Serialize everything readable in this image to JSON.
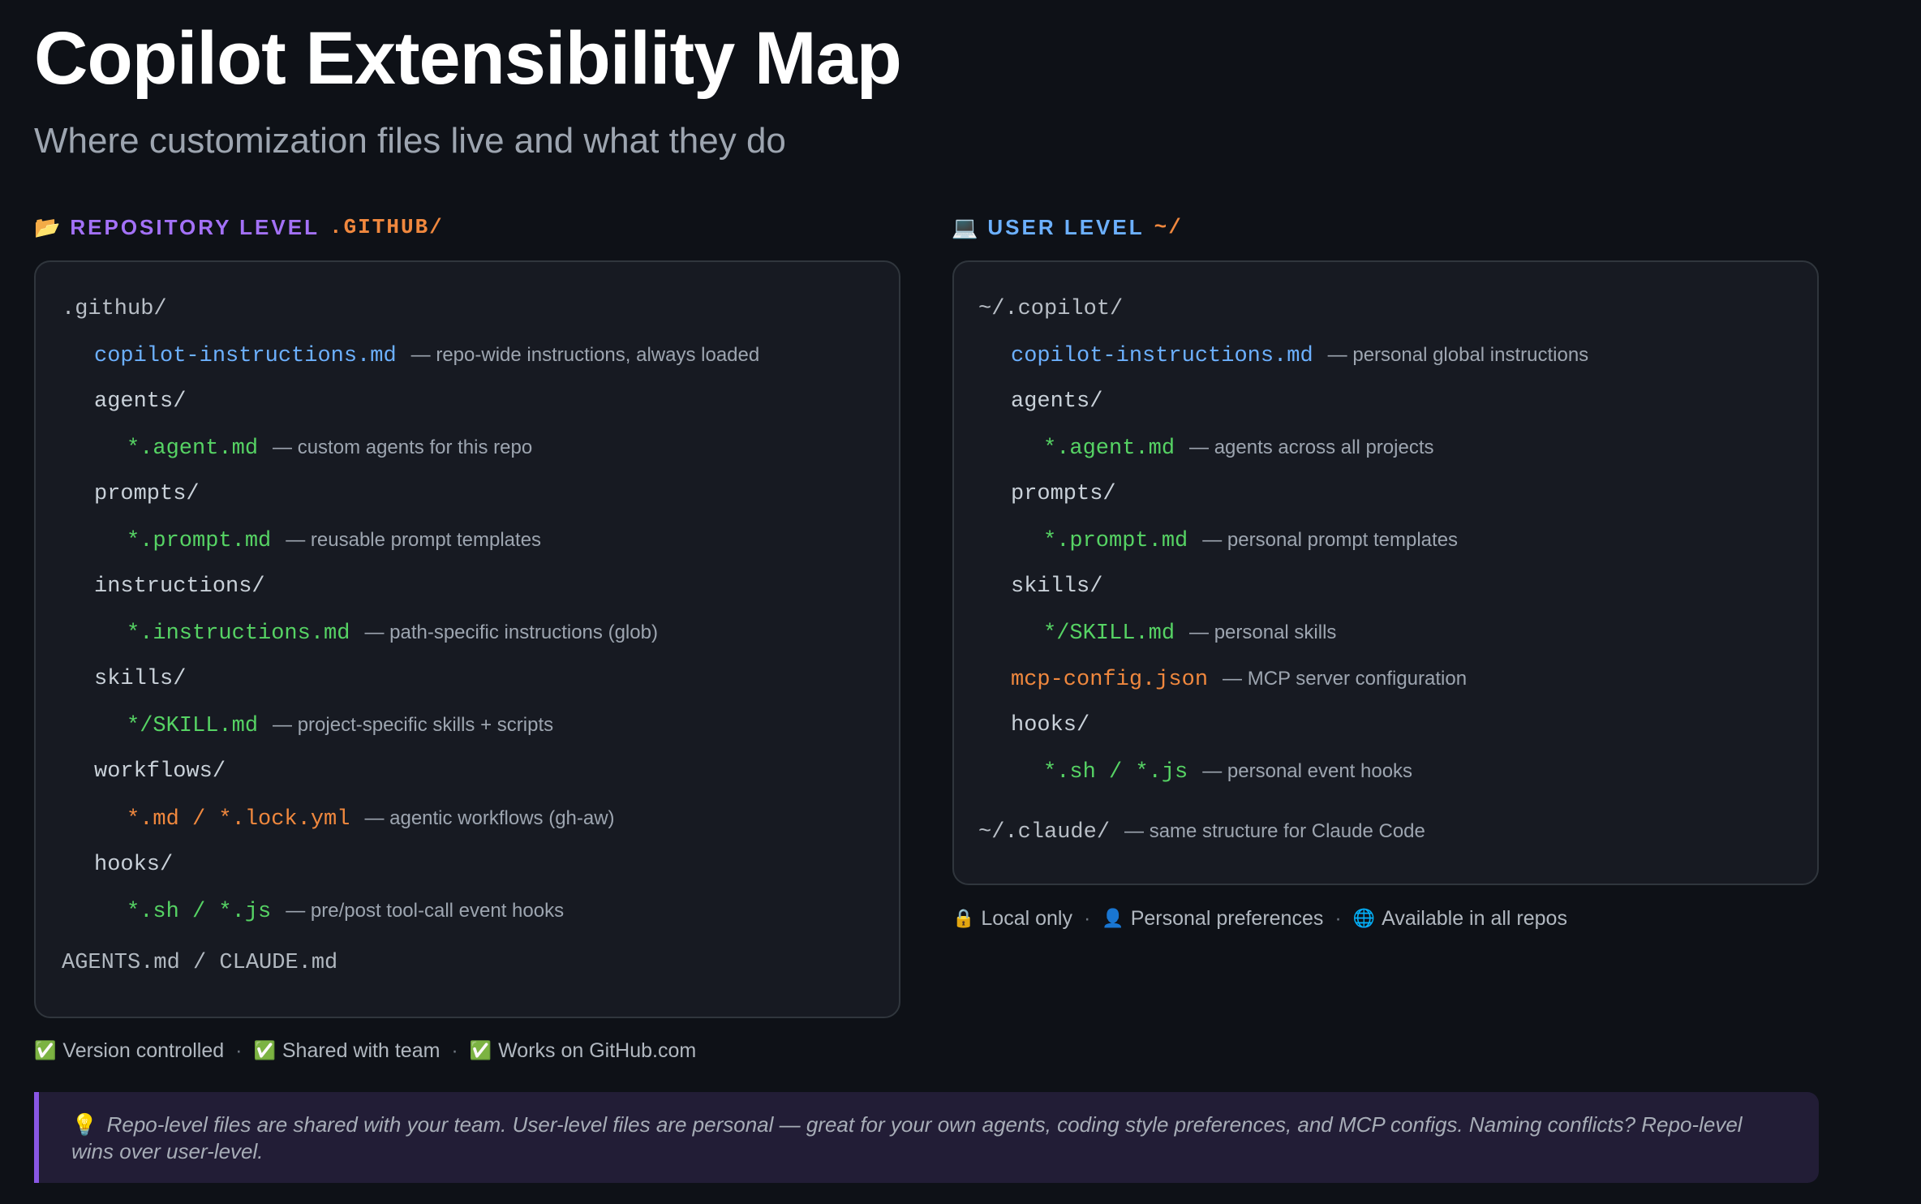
{
  "title": "Copilot Extensibility Map",
  "subtitle": "Where customization files live and what they do",
  "repo": {
    "icon": "folder-icon",
    "icon_glyph": "📂",
    "label": "REPOSITORY LEVEL",
    "path": ".GITHUB/",
    "tree": {
      "root": ".github/",
      "copilot_instructions": {
        "name": "copilot-instructions.md",
        "desc": "— repo-wide instructions, always loaded"
      },
      "agents_dir": "agents/",
      "agent_file": {
        "name": "*.agent.md",
        "desc": "— custom agents for this repo"
      },
      "prompts_dir": "prompts/",
      "prompt_file": {
        "name": "*.prompt.md",
        "desc": "— reusable prompt templates"
      },
      "instructions_dir": "instructions/",
      "instructions_file": {
        "name": "*.instructions.md",
        "desc": "— path-specific instructions (glob)"
      },
      "skills_dir": "skills/",
      "skill_file": {
        "name": "*/SKILL.md",
        "desc": "— project-specific skills + scripts"
      },
      "workflows_dir": "workflows/",
      "workflow_file": {
        "name": "*.md / *.lock.yml",
        "desc": "— agentic workflows (gh-aw)"
      },
      "hooks_dir": "hooks/",
      "hook_file": {
        "name": "*.sh / *.js",
        "desc": "— pre/post tool-call event hooks"
      },
      "agents_md": "AGENTS.md / CLAUDE.md"
    },
    "footer": [
      {
        "icon": "check-icon",
        "glyph": "✅",
        "text": "Version controlled"
      },
      {
        "icon": "check-icon",
        "glyph": "✅",
        "text": "Shared with team"
      },
      {
        "icon": "check-icon",
        "glyph": "✅",
        "text": "Works on GitHub.com"
      }
    ]
  },
  "user": {
    "icon": "laptop-icon",
    "icon_glyph": "💻",
    "label": "USER LEVEL",
    "path": "~/",
    "tree": {
      "root": "~/.copilot/",
      "copilot_instructions": {
        "name": "copilot-instructions.md",
        "desc": "— personal global instructions"
      },
      "agents_dir": "agents/",
      "agent_file": {
        "name": "*.agent.md",
        "desc": "— agents across all projects"
      },
      "prompts_dir": "prompts/",
      "prompt_file": {
        "name": "*.prompt.md",
        "desc": "— personal prompt templates"
      },
      "skills_dir": "skills/",
      "skill_file": {
        "name": "*/SKILL.md",
        "desc": "— personal skills"
      },
      "mcp_config": {
        "name": "mcp-config.json",
        "desc": "— MCP server configuration"
      },
      "hooks_dir": "hooks/",
      "hook_file": {
        "name": "*.sh / *.js",
        "desc": "— personal event hooks"
      },
      "claude": {
        "name": "~/.claude/",
        "desc": "— same structure for Claude Code"
      }
    },
    "footer": [
      {
        "icon": "lock-icon",
        "glyph": "🔒",
        "text": "Local only"
      },
      {
        "icon": "person-icon",
        "glyph": "👤",
        "text": "Personal preferences"
      },
      {
        "icon": "globe-icon",
        "glyph": "🌐",
        "text": "Available in all repos"
      }
    ]
  },
  "footer_separator": "·",
  "tip": {
    "icon": "lightbulb-icon",
    "glyph": "💡",
    "text": "Repo-level files are shared with your team. User-level files are personal — great for your own agents, coding style preferences, and MCP configs. Naming conflicts? Repo-level wins over user-level."
  },
  "colors": {
    "background": "#0e1117",
    "panel": "#171a22",
    "repo_accent": "#a371f7",
    "user_accent": "#6cb0ff",
    "path_orange": "#f0883e",
    "file_green": "#56d364",
    "file_blue": "#6cb0ff",
    "tip_background": "#221d36",
    "tip_border": "#8957e5"
  }
}
